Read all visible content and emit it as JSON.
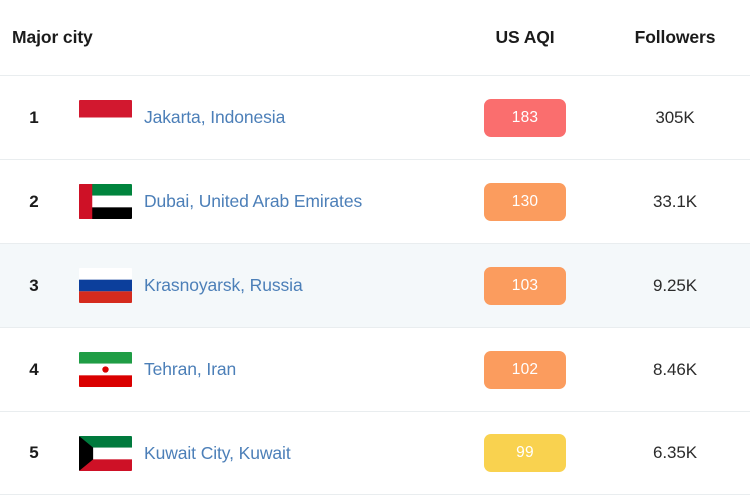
{
  "table": {
    "columns": {
      "city": "Major city",
      "aqi": "US AQI",
      "followers": "Followers"
    },
    "rows": [
      {
        "rank": "1",
        "city": "Jakarta, Indonesia",
        "flag": "flag-indonesia",
        "aqi": "183",
        "aqi_color": "#fa6e6e",
        "followers": "305K",
        "highlighted": false
      },
      {
        "rank": "2",
        "city": "Dubai, United Arab Emirates",
        "flag": "flag-united-arab-emirates",
        "aqi": "130",
        "aqi_color": "#fb9c5e",
        "followers": "33.1K",
        "highlighted": false
      },
      {
        "rank": "3",
        "city": "Krasnoyarsk, Russia",
        "flag": "flag-russia",
        "aqi": "103",
        "aqi_color": "#fb9c5e",
        "followers": "9.25K",
        "highlighted": true
      },
      {
        "rank": "4",
        "city": "Tehran, Iran",
        "flag": "flag-iran",
        "aqi": "102",
        "aqi_color": "#fb9c5e",
        "followers": "8.46K",
        "highlighted": false
      },
      {
        "rank": "5",
        "city": "Kuwait City, Kuwait",
        "flag": "flag-kuwait",
        "aqi": "99",
        "aqi_color": "#f9d24f",
        "followers": "6.35K",
        "highlighted": false
      }
    ]
  },
  "colors": {
    "link": "#4c7fb8",
    "row_highlight": "#f4f8fa",
    "divider": "#e9edef",
    "aqi_unhealthy": "#fa6e6e",
    "aqi_unhealthy_sensitive": "#fb9c5e",
    "aqi_moderate": "#f9d24f"
  }
}
